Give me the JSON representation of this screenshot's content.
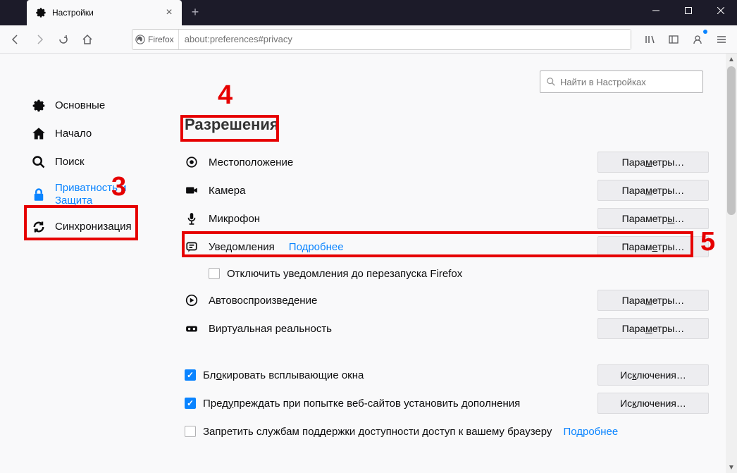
{
  "tab": {
    "title": "Настройки"
  },
  "urlbar": {
    "identity_label": "Firefox",
    "url": "about:preferences#privacy"
  },
  "search": {
    "placeholder": "Найти в Настройках"
  },
  "sidebar": {
    "items": [
      {
        "label": "Основные"
      },
      {
        "label": "Начало"
      },
      {
        "label": "Поиск"
      },
      {
        "label": "Приватность и Защита"
      },
      {
        "label": "Синхронизация"
      }
    ]
  },
  "section": {
    "title": "Разрешения"
  },
  "permissions": {
    "location": {
      "label": "Местоположение",
      "btn_pre": "Пара",
      "btn_ul": "м",
      "btn_post": "етры…"
    },
    "camera": {
      "label": "Камера",
      "btn_pre": "Пара",
      "btn_ul": "м",
      "btn_post": "етры…"
    },
    "microphone": {
      "label": "Микрофон",
      "btn_pre": "Параметр",
      "btn_ul": "ы",
      "btn_post": "…"
    },
    "notifications": {
      "label": "Уведомления",
      "link": "Подробнее",
      "btn_pre": "Парам",
      "btn_ul": "е",
      "btn_post": "тры…"
    },
    "notifications_sub": {
      "label": "Отключить уведомления до перезапуска Firefox"
    },
    "autoplay": {
      "label": "Автовоспроизведение",
      "btn_pre": "Пара",
      "btn_ul": "м",
      "btn_post": "етры…"
    },
    "vr": {
      "label": "Виртуальная реальность",
      "btn_pre": "Пара",
      "btn_ul": "м",
      "btn_post": "етры…"
    }
  },
  "blocking": {
    "popups": {
      "label_pre": "Бл",
      "label_ul": "о",
      "label_post": "кировать всплывающие окна",
      "btn_pre": "Ис",
      "btn_ul": "к",
      "btn_post": "лючения…"
    },
    "addons": {
      "label_pre": "Пред",
      "label_ul": "у",
      "label_post": "преждать при попытке веб-сайтов установить дополнения",
      "btn_pre": "Ис",
      "btn_ul": "к",
      "btn_post": "лючения…"
    },
    "accessibility": {
      "label": "Запретить службам поддержки доступности доступ к вашему браузеру",
      "link": "Подробнее"
    }
  },
  "annotations": {
    "n3": "3",
    "n4": "4",
    "n5": "5"
  }
}
